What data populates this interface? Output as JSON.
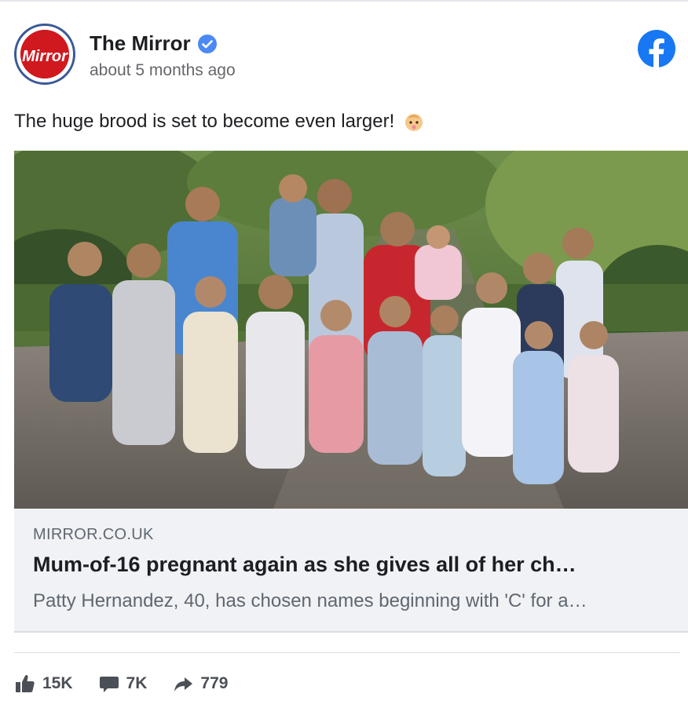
{
  "post": {
    "page_name": "The Mirror",
    "timestamp": "about 5 months ago",
    "text": "The huge brood is set to become even larger!",
    "avatar_text": "Mirror"
  },
  "link": {
    "domain": "MIRROR.CO.UK",
    "title": "Mum-of-16 pregnant again as she gives all of her ch…",
    "description": "Patty Hernandez, 40, has chosen names beginning with 'C' for a…"
  },
  "actions": {
    "likes": "15K",
    "comments": "7K",
    "shares": "779"
  },
  "icons": {
    "verified": "verified-badge-icon",
    "platform": "facebook-icon",
    "emoji": "baby-emoji-icon",
    "like": "thumbs-up-icon",
    "comment": "comment-icon",
    "share": "share-arrow-icon"
  },
  "colors": {
    "brand_blue": "#1877f2",
    "mirror_red": "#d0191f",
    "text_primary": "#1c1e21",
    "text_secondary": "#65676b"
  }
}
